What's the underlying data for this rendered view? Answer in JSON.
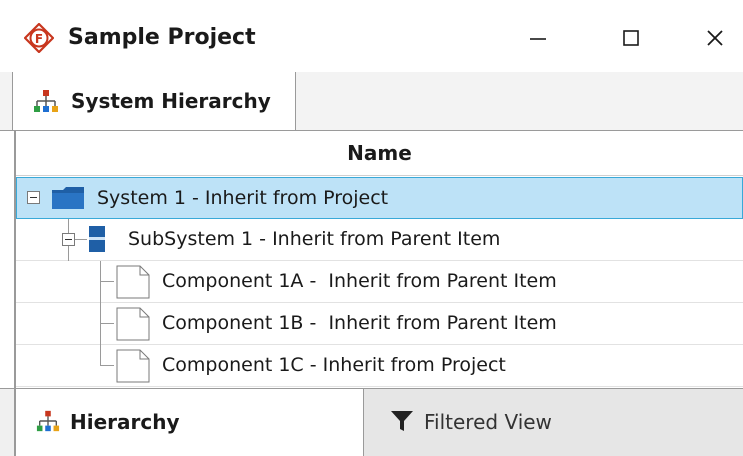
{
  "window": {
    "title": "Sample Project",
    "app_icon": "f-diamond-icon",
    "minimize_glyph": "—",
    "maximize_glyph": "☐",
    "close_glyph": "✕"
  },
  "doc_tabs": [
    {
      "label": "System Hierarchy",
      "icon": "hierarchy-icon",
      "active": true
    }
  ],
  "grid": {
    "column_header": "Name",
    "rows": [
      {
        "label": "System 1 - Inherit from Project",
        "type": "system",
        "icon": "folder-icon",
        "expanded": true,
        "selected": true
      },
      {
        "label": "SubSystem 1 - Inherit from Parent Item",
        "type": "subsystem",
        "icon": "subsystem-icon",
        "expanded": true,
        "selected": false
      },
      {
        "label": "Component 1A -  Inherit from Parent Item",
        "type": "component",
        "icon": "document-icon",
        "selected": false
      },
      {
        "label": "Component 1B -  Inherit from Parent Item",
        "type": "component",
        "icon": "document-icon",
        "selected": false
      },
      {
        "label": "Component 1C - Inherit from Project",
        "type": "component",
        "icon": "document-icon",
        "selected": false
      }
    ]
  },
  "bottom_tabs": [
    {
      "label": "Hierarchy",
      "icon": "hierarchy-icon",
      "active": true
    },
    {
      "label": "Filtered View",
      "icon": "filter-icon",
      "active": false
    }
  ],
  "colors": {
    "accent_red": "#c8361e",
    "selection_bg": "#bde2f7",
    "selection_border": "#39a9d8",
    "folder_blue": "#1f5fa6"
  }
}
